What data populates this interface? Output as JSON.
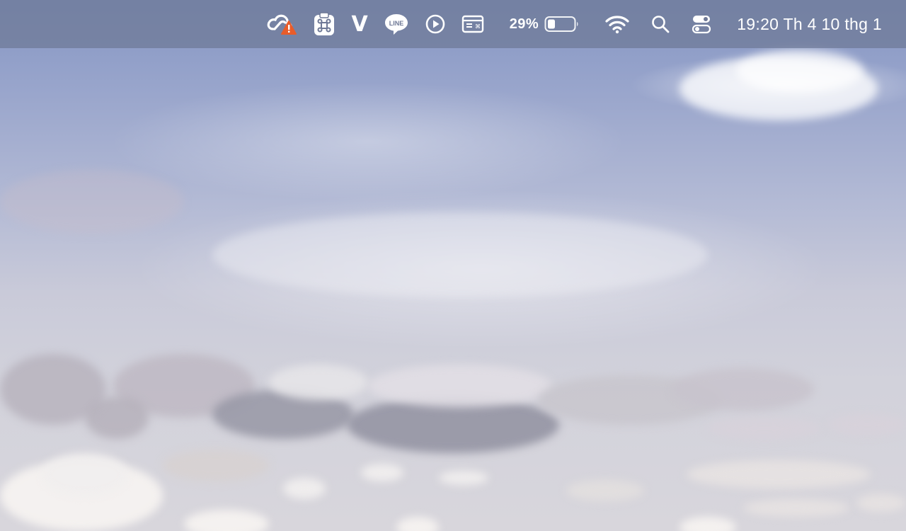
{
  "menubar": {
    "items": [
      {
        "name": "creative-cloud-icon",
        "alert": true
      },
      {
        "name": "command-clipboard-icon"
      },
      {
        "name": "v-app-icon",
        "glyph": "V"
      },
      {
        "name": "line-app-icon",
        "glyph": "LINE"
      },
      {
        "name": "play-circle-icon"
      },
      {
        "name": "keyboard-window-icon"
      }
    ],
    "battery": {
      "label": "29%",
      "level": 0.29
    },
    "wifi_icon": "wifi-icon",
    "search_icon": "search-icon",
    "control_center_icon": "control-center-icon",
    "clock": "19:20 Th 4 10 thg 1"
  },
  "colors": {
    "menubar_bg": "#6e7896",
    "alert": "#e85c2a",
    "icon": "#ffffff"
  },
  "wallpaper": {
    "subject": "sky-with-clouds"
  }
}
